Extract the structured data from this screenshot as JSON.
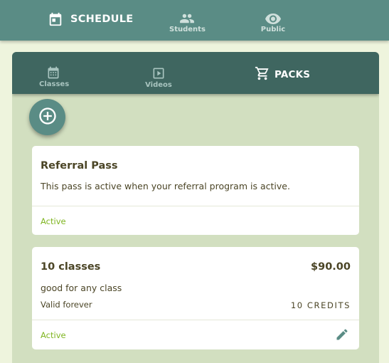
{
  "topnav": {
    "schedule_label": "SCHEDULE",
    "students_label": "Students",
    "public_label": "Public"
  },
  "subnav": {
    "classes_label": "Classes",
    "videos_label": "Videos",
    "packs_label": "PACKS"
  },
  "packs": [
    {
      "title": "Referral Pass",
      "description": "This pass is active when your referral program is active.",
      "status": "Active"
    },
    {
      "title": "10 classes",
      "price": "$90.00",
      "description": "good for any class",
      "validity": "Valid forever",
      "credits": "10 CREDITS",
      "status": "Active"
    }
  ],
  "colors": {
    "topbar": "#5a8c85",
    "subbar": "#3f6660",
    "panel": "#d2dfc0",
    "background": "#eef4dd",
    "status_active": "#7fb520",
    "text": "#4b4526"
  },
  "icons": {
    "schedule": "calendar-icon",
    "students": "people-icon",
    "public": "eye-icon",
    "classes": "calendar-icon",
    "videos": "play-icon",
    "packs": "cart-icon",
    "add": "add-circle-icon",
    "edit": "pencil-icon"
  }
}
